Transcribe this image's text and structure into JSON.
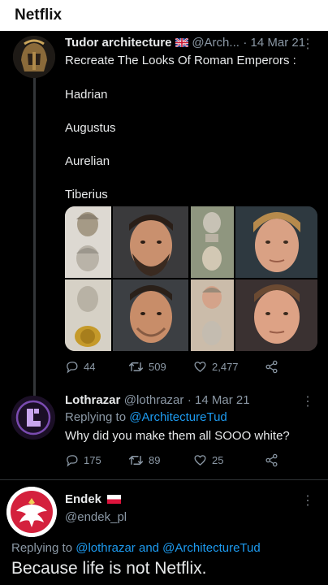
{
  "header": {
    "title": "Netflix"
  },
  "tweet1": {
    "author": "Tudor architecture",
    "handle": "@Arch...",
    "date": "· 14 Mar 21",
    "text": "Recreate The Looks Of Roman Emperors :",
    "emperors": [
      "Hadrian",
      "Augustus",
      "Aurelian",
      "Tiberius"
    ],
    "replies": "44",
    "retweets": "509",
    "likes": "2,477"
  },
  "tweet2": {
    "author": "Lothrazar",
    "handle": "@lothrazar",
    "date": "· 14 Mar 21",
    "replying_prefix": "Replying to",
    "replying_to": "@ArchitectureTud",
    "text": "Why did you make them all SOOO white?",
    "replies": "175",
    "retweets": "89",
    "likes": "25"
  },
  "tweet3": {
    "author": "Endek",
    "handle": "@endek_pl",
    "replying_prefix": "Replying to",
    "replying_to": "@lothrazar and @ArchitectureTud",
    "text": "Because life is not Netflix."
  },
  "colors": {
    "accent": "#1d9bf0",
    "muted": "#8b98a5",
    "background": "#000000"
  }
}
